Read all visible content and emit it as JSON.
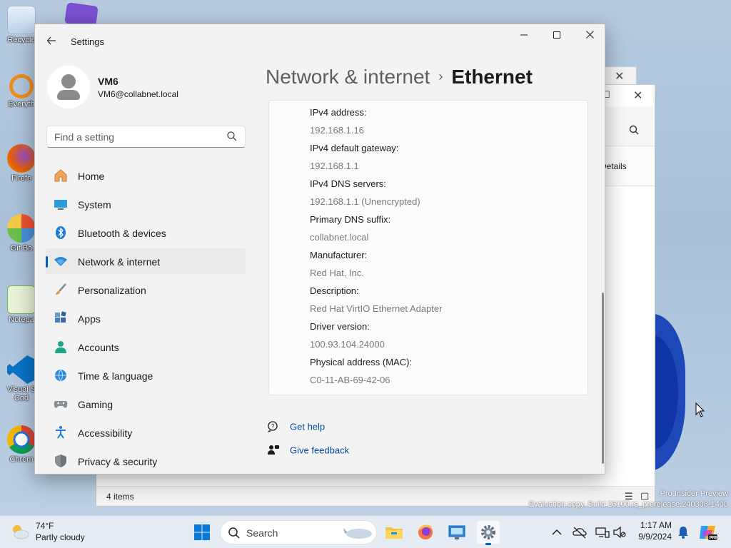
{
  "desktop": {
    "icons": [
      {
        "label": "Recycle"
      },
      {
        "label": "Everyth"
      },
      {
        "label": "Firefo"
      },
      {
        "label": "Git Ba"
      },
      {
        "label": "Notepa"
      },
      {
        "label": "Visual S\nCod"
      },
      {
        "label": "Chrom"
      }
    ],
    "watermark_line1": "Pro Insider Preview",
    "watermark_line2": "Evaluation copy. Build 26100.rs_prerelease.240308-1400"
  },
  "background_window": {
    "details_label": "Details",
    "status_items": "4 items"
  },
  "settings": {
    "app_title": "Settings",
    "profile": {
      "name": "VM6",
      "email": "VM6@collabnet.local"
    },
    "search_placeholder": "Find a setting",
    "nav": [
      {
        "label": "Home",
        "icon": "home-icon"
      },
      {
        "label": "System",
        "icon": "system-icon"
      },
      {
        "label": "Bluetooth & devices",
        "icon": "bluetooth-icon"
      },
      {
        "label": "Network & internet",
        "icon": "wifi-icon",
        "active": true
      },
      {
        "label": "Personalization",
        "icon": "brush-icon"
      },
      {
        "label": "Apps",
        "icon": "apps-icon"
      },
      {
        "label": "Accounts",
        "icon": "account-icon"
      },
      {
        "label": "Time & language",
        "icon": "globe-clock-icon"
      },
      {
        "label": "Gaming",
        "icon": "gamepad-icon"
      },
      {
        "label": "Accessibility",
        "icon": "accessibility-icon"
      },
      {
        "label": "Privacy & security",
        "icon": "shield-icon"
      }
    ],
    "breadcrumb": {
      "parent": "Network & internet",
      "separator": "›",
      "current": "Ethernet"
    },
    "properties": [
      {
        "key": "IPv4 address:",
        "value": "192.168.1.16"
      },
      {
        "key": "IPv4 default gateway:",
        "value": "192.168.1.1"
      },
      {
        "key": "IPv4 DNS servers:",
        "value": "192.168.1.1 (Unencrypted)"
      },
      {
        "key": "Primary DNS suffix:",
        "value": "collabnet.local"
      },
      {
        "key": "Manufacturer:",
        "value": "Red Hat, Inc."
      },
      {
        "key": "Description:",
        "value": "Red Hat VirtIO Ethernet Adapter"
      },
      {
        "key": "Driver version:",
        "value": "100.93.104.24000"
      },
      {
        "key": "Physical address (MAC):",
        "value": "C0-11-AB-69-42-06"
      }
    ],
    "get_help": "Get help",
    "give_feedback": "Give feedback"
  },
  "taskbar": {
    "weather_temp": "74°F",
    "weather_condition": "Partly cloudy",
    "search_label": "Search",
    "time": "1:17 AM",
    "date": "9/9/2024"
  },
  "colors": {
    "accent": "#005fb8",
    "link": "#004a9e"
  }
}
